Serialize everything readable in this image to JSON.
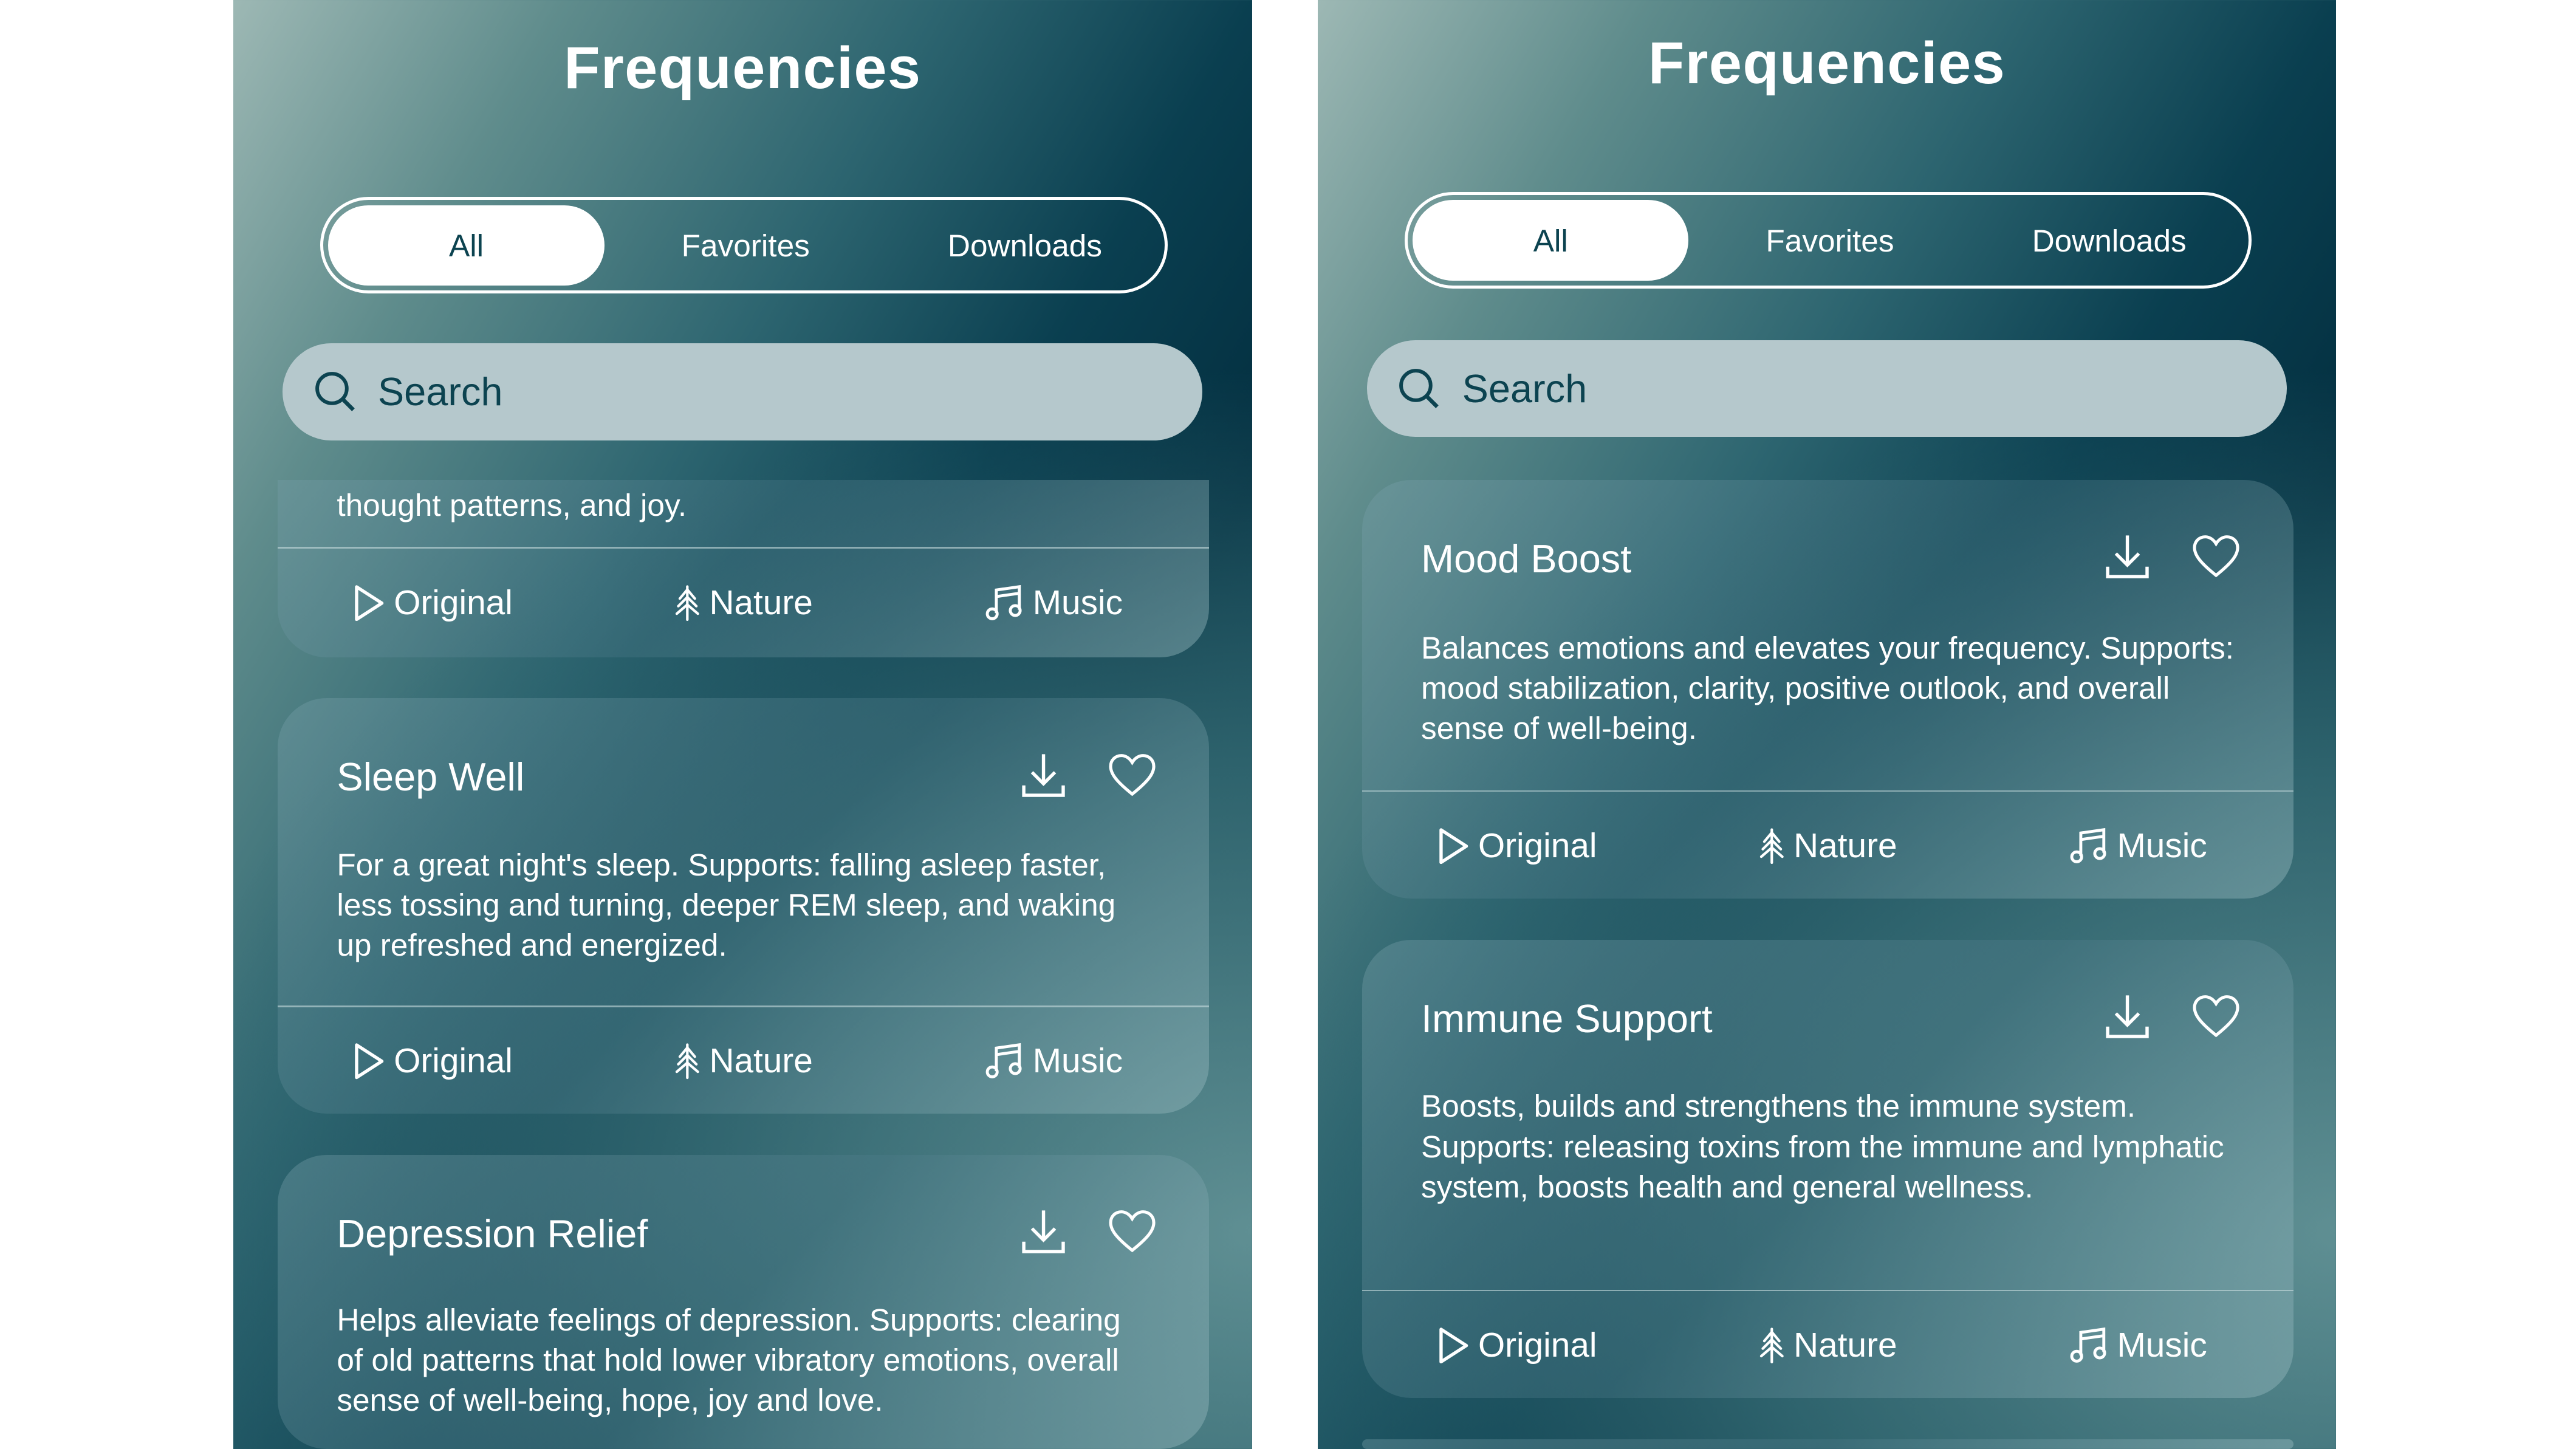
{
  "colors": {
    "accent_text": "#0c4350",
    "search_bg": "#b5c8cc",
    "background_dark": "#032f40"
  },
  "phones": [
    {
      "title": "Frequencies",
      "tabs": [
        {
          "label": "All",
          "active": true
        },
        {
          "label": "Favorites",
          "active": false
        },
        {
          "label": "Downloads",
          "active": false
        }
      ],
      "search": {
        "placeholder": "Search",
        "icon": "search-icon"
      },
      "cards": [
        {
          "title": "",
          "description": "thought patterns, and joy.",
          "partial_top": true,
          "actions": [
            {
              "label": "Original",
              "icon": "play-icon"
            },
            {
              "label": "Nature",
              "icon": "tree-icon"
            },
            {
              "label": "Music",
              "icon": "music-note-icon"
            }
          ]
        },
        {
          "title": "Sleep Well",
          "description": "For a great night's sleep. Supports: falling asleep faster, less tossing and turning, deeper REM sleep, and waking up refreshed and energized.",
          "actions": [
            {
              "label": "Original",
              "icon": "play-icon"
            },
            {
              "label": "Nature",
              "icon": "tree-icon"
            },
            {
              "label": "Music",
              "icon": "music-note-icon"
            }
          ]
        },
        {
          "title": "Depression Relief",
          "description": "Helps alleviate feelings of depression. Supports: clearing of old patterns that hold lower vibratory emotions, overall sense of well-being, hope, joy and love.",
          "actions": [
            {
              "label": "Original",
              "icon": "play-icon"
            },
            {
              "label": "Nature",
              "icon": "tree-icon"
            },
            {
              "label": "Music",
              "icon": "music-note-icon"
            }
          ]
        }
      ]
    },
    {
      "title": "Frequencies",
      "tabs": [
        {
          "label": "All",
          "active": true
        },
        {
          "label": "Favorites",
          "active": false
        },
        {
          "label": "Downloads",
          "active": false
        }
      ],
      "search": {
        "placeholder": "Search",
        "icon": "search-icon"
      },
      "cards": [
        {
          "title": "Mood Boost",
          "description": "Balances emotions and elevates your frequency. Supports: mood stabilization, clarity, positive outlook, and overall sense of well-being.",
          "actions": [
            {
              "label": "Original",
              "icon": "play-icon"
            },
            {
              "label": "Nature",
              "icon": "tree-icon"
            },
            {
              "label": "Music",
              "icon": "music-note-icon"
            }
          ]
        },
        {
          "title": "Immune Support",
          "description": "Boosts, builds and strengthens the immune system. Supports: releasing toxins from the immune and lymphatic system, boosts health and general wellness.",
          "actions": [
            {
              "label": "Original",
              "icon": "play-icon"
            },
            {
              "label": "Nature",
              "icon": "tree-icon"
            },
            {
              "label": "Music",
              "icon": "music-note-icon"
            }
          ]
        },
        {
          "title": "",
          "description": "",
          "actions": []
        }
      ]
    }
  ]
}
